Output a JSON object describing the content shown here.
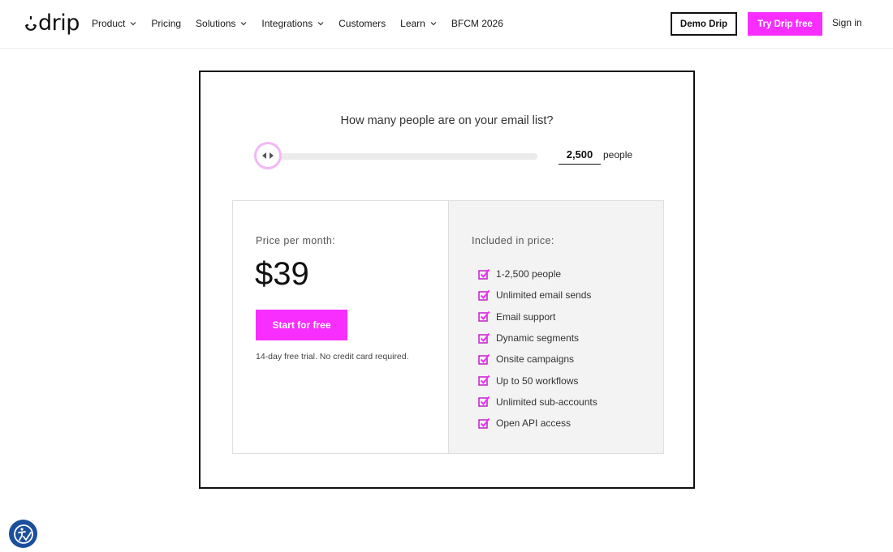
{
  "header": {
    "logo_text": "drip",
    "nav": [
      {
        "label": "Product",
        "has_dropdown": true
      },
      {
        "label": "Pricing",
        "has_dropdown": false
      },
      {
        "label": "Solutions",
        "has_dropdown": true
      },
      {
        "label": "Integrations",
        "has_dropdown": true
      },
      {
        "label": "Customers",
        "has_dropdown": false
      },
      {
        "label": "Learn",
        "has_dropdown": true
      },
      {
        "label": "BFCM 2026",
        "has_dropdown": false
      }
    ],
    "demo_label": "Demo Drip",
    "try_label": "Try Drip free",
    "signin_label": "Sign in"
  },
  "pricing": {
    "question": "How many people are on your email list?",
    "slider_fraction": 0.0,
    "people_value": "2,500",
    "people_unit": "people",
    "price_label": "Price per month:",
    "price": "$39",
    "cta_label": "Start for free",
    "trial_note": "14-day free trial. No credit card required.",
    "included_label": "Included in price:",
    "features": [
      "1-2,500 people",
      "Unlimited email sends",
      "Email support",
      "Dynamic segments",
      "Onsite campaigns",
      "Up to 50 workflows",
      "Unlimited sub-accounts",
      "Open API access"
    ]
  },
  "colors": {
    "accent": "#f72eff",
    "accessibility_badge": "#1b4f9c"
  },
  "icons": {
    "logo": "drip-logo-icon",
    "dropdown": "chevron-down-icon",
    "slider_thumb": "slider-arrows-icon",
    "feature_check": "checkbox-checked-icon",
    "accessibility": "accessibility-icon"
  }
}
